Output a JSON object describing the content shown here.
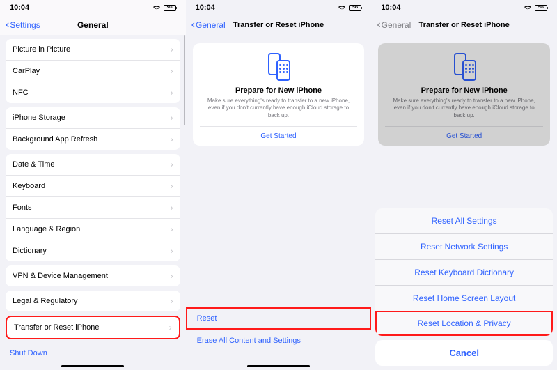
{
  "status": {
    "time": "10:04",
    "battery": "5G"
  },
  "screen1": {
    "back": "Settings",
    "title": "General",
    "groups": [
      [
        "Picture in Picture",
        "CarPlay",
        "NFC"
      ],
      [
        "iPhone Storage",
        "Background App Refresh"
      ],
      [
        "Date & Time",
        "Keyboard",
        "Fonts",
        "Language & Region",
        "Dictionary"
      ],
      [
        "VPN & Device Management"
      ],
      [
        "Legal & Regulatory"
      ],
      [
        "Transfer or Reset iPhone"
      ]
    ],
    "shutdown": "Shut Down"
  },
  "screen2": {
    "back": "General",
    "title": "Transfer or Reset iPhone",
    "card": {
      "heading": "Prepare for New iPhone",
      "body": "Make sure everything's ready to transfer to a new iPhone, even if you don't currently have enough iCloud storage to back up.",
      "cta": "Get Started"
    },
    "reset": "Reset",
    "erase": "Erase All Content and Settings"
  },
  "screen3": {
    "back": "General",
    "title": "Transfer or Reset iPhone",
    "card": {
      "heading": "Prepare for New iPhone",
      "body": "Make sure everything's ready to transfer to a new iPhone, even if you don't currently have enough iCloud storage to back up.",
      "cta": "Get Started"
    },
    "sheet": {
      "options": [
        "Reset All Settings",
        "Reset Network Settings",
        "Reset Keyboard Dictionary",
        "Reset Home Screen Layout",
        "Reset Location & Privacy"
      ],
      "cancel": "Cancel"
    }
  }
}
